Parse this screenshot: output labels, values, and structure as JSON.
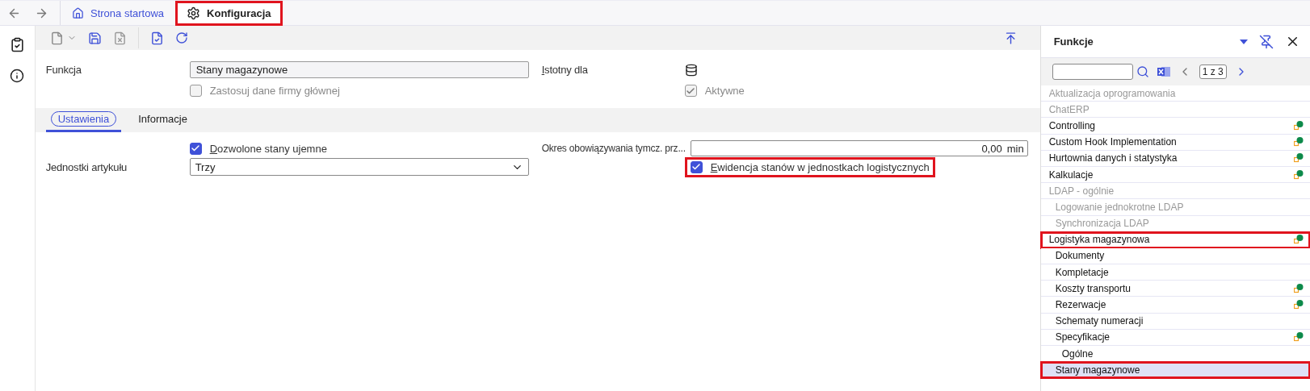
{
  "nav": {
    "tabs": [
      {
        "label": "Strona startowa",
        "kind": "home",
        "selected": false,
        "highlighted": false
      },
      {
        "label": "Konfiguracja",
        "kind": "gear",
        "selected": true,
        "highlighted": true
      }
    ]
  },
  "form": {
    "function_label": "Funkcja",
    "function_value": "Stany magazynowe",
    "apply_parent": {
      "label": "Zastosuj dane firmy głównej",
      "checked": false,
      "disabled": true
    },
    "relevant_label": "Istotny dla",
    "active": {
      "label": "Aktywne",
      "checked": true,
      "disabled": true
    }
  },
  "tabs": [
    {
      "label": "Ustawienia",
      "selected": true
    },
    {
      "label": "Informacje",
      "selected": false
    }
  ],
  "settings": {
    "negative_stock": {
      "label": "Dozwolone stany ujemne",
      "checked": true,
      "highlighted": false
    },
    "units_label": "Jednostki artykułu",
    "units_value": "Trzy",
    "period_label": "Okres obowiązywania tymcz. prz...",
    "period_value": "0,00",
    "period_unit": "min",
    "logistic_units": {
      "label": "Ewidencja stanów w jednostkach logistycznych",
      "checked": true,
      "highlighted": true
    }
  },
  "panel": {
    "title": "Funkcje",
    "page": "1 z 3",
    "items": [
      {
        "label": "Aktualizacja oprogramowania",
        "disabled": true,
        "status": false,
        "selected": false,
        "highlighted": false
      },
      {
        "label": "ChatERP",
        "disabled": true,
        "status": false,
        "selected": false,
        "highlighted": false
      },
      {
        "label": "Controlling",
        "disabled": false,
        "status": true,
        "selected": false,
        "highlighted": false
      },
      {
        "label": "Custom Hook Implementation",
        "disabled": false,
        "status": true,
        "selected": false,
        "highlighted": false
      },
      {
        "label": "Hurtownia danych i statystyka",
        "disabled": false,
        "status": true,
        "selected": false,
        "highlighted": false
      },
      {
        "label": "Kalkulacje",
        "disabled": false,
        "status": true,
        "selected": false,
        "highlighted": false
      },
      {
        "label": "LDAP - ogólnie",
        "disabled": true,
        "status": false,
        "selected": false,
        "highlighted": false,
        "children": [
          {
            "label": "Logowanie jednokrotne LDAP",
            "disabled": true,
            "status": false,
            "selected": false,
            "highlighted": false
          },
          {
            "label": "Synchronizacja LDAP",
            "disabled": true,
            "status": false,
            "selected": false,
            "highlighted": false
          }
        ]
      },
      {
        "label": "Logistyka magazynowa",
        "disabled": false,
        "status": true,
        "selected": false,
        "highlighted": true,
        "children": [
          {
            "label": "Dokumenty",
            "disabled": false,
            "status": false,
            "selected": false,
            "highlighted": false
          },
          {
            "label": "Kompletacje",
            "disabled": false,
            "status": false,
            "selected": false,
            "highlighted": false
          },
          {
            "label": "Koszty transportu",
            "disabled": false,
            "status": true,
            "selected": false,
            "highlighted": false
          },
          {
            "label": "Rezerwacje",
            "disabled": false,
            "status": true,
            "selected": false,
            "highlighted": false
          },
          {
            "label": "Schematy numeracji",
            "disabled": false,
            "status": false,
            "selected": false,
            "highlighted": false
          },
          {
            "label": "Specyfikacje",
            "disabled": false,
            "status": true,
            "selected": false,
            "highlighted": false,
            "children": [
              {
                "label": "Ogólne",
                "disabled": false,
                "status": false,
                "selected": false,
                "highlighted": false
              }
            ]
          },
          {
            "label": "Stany magazynowe",
            "disabled": false,
            "status": false,
            "selected": true,
            "highlighted": true
          }
        ]
      }
    ]
  }
}
